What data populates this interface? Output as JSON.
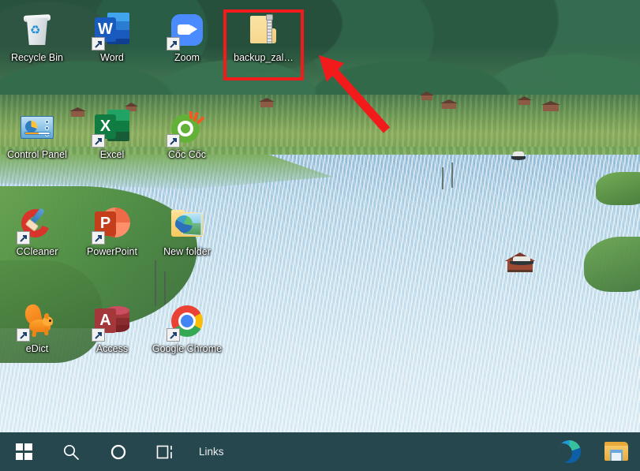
{
  "desktop": {
    "wallpaper_description": "Aerial photo of a river winding through green terraced fields with karst mountains",
    "colors": {
      "annotation_red": "#f21b1b",
      "taskbar": "#27474f",
      "label_text": "#ffffff"
    },
    "icons": [
      {
        "id": "recycle-bin",
        "label": "Recycle Bin",
        "icon": "recycle-bin-icon",
        "shortcut": false,
        "col": 0,
        "row": 0
      },
      {
        "id": "word",
        "label": "Word",
        "icon": "word-icon",
        "shortcut": true,
        "col": 1,
        "row": 0
      },
      {
        "id": "zoom",
        "label": "Zoom",
        "icon": "zoom-icon",
        "shortcut": true,
        "col": 2,
        "row": 0
      },
      {
        "id": "backup-zip",
        "label": "backup_zal…",
        "icon": "zip-folder-icon",
        "shortcut": false,
        "col": 3,
        "row": 0,
        "highlighted": true
      },
      {
        "id": "control-panel",
        "label": "Control Panel",
        "icon": "control-panel-icon",
        "shortcut": false,
        "col": 0,
        "row": 1
      },
      {
        "id": "excel",
        "label": "Excel",
        "icon": "excel-icon",
        "shortcut": true,
        "col": 1,
        "row": 1
      },
      {
        "id": "coc-coc",
        "label": "Cốc Cốc",
        "icon": "coc-coc-icon",
        "shortcut": true,
        "col": 2,
        "row": 1
      },
      {
        "id": "ccleaner",
        "label": "CCleaner",
        "icon": "ccleaner-icon",
        "shortcut": true,
        "col": 0,
        "row": 2
      },
      {
        "id": "powerpoint",
        "label": "PowerPoint",
        "icon": "powerpoint-icon",
        "shortcut": true,
        "col": 1,
        "row": 2
      },
      {
        "id": "new-folder",
        "label": "New folder",
        "icon": "folder-picture-icon",
        "shortcut": false,
        "col": 2,
        "row": 2
      },
      {
        "id": "edict",
        "label": "eDict",
        "icon": "edict-squirrel-icon",
        "shortcut": true,
        "col": 0,
        "row": 3
      },
      {
        "id": "access",
        "label": "Access",
        "icon": "access-icon",
        "shortcut": true,
        "col": 1,
        "row": 3
      },
      {
        "id": "chrome",
        "label": "Google Chrome",
        "icon": "chrome-icon",
        "shortcut": true,
        "col": 2,
        "row": 3
      }
    ]
  },
  "annotations": {
    "highlight_rect": {
      "target": "backup-zip",
      "color": "#f21b1b"
    },
    "arrow": {
      "points_to": "backup-zip",
      "color": "#f21b1b",
      "direction": "up-left"
    }
  },
  "taskbar": {
    "start_button": "start-button",
    "search_icon": "search-icon",
    "cortana_icon": "cortana-icon",
    "task_view_icon": "task-view-icon",
    "links_toolbar_label": "Links",
    "pinned": [
      {
        "id": "edge",
        "label": "Microsoft Edge",
        "icon": "edge-icon"
      },
      {
        "id": "file-explorer",
        "label": "File Explorer",
        "icon": "file-explorer-icon"
      }
    ]
  }
}
